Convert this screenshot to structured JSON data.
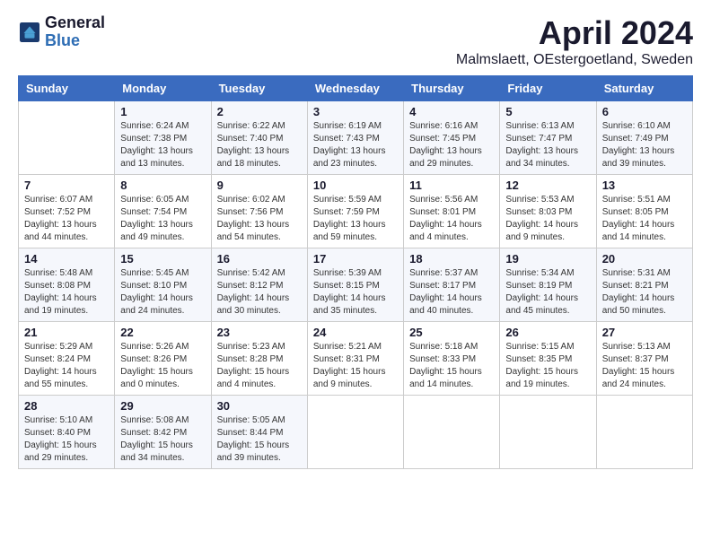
{
  "header": {
    "logo_general": "General",
    "logo_blue": "Blue",
    "month_title": "April 2024",
    "location": "Malmslaett, OEstergoetland, Sweden"
  },
  "calendar": {
    "days_of_week": [
      "Sunday",
      "Monday",
      "Tuesday",
      "Wednesday",
      "Thursday",
      "Friday",
      "Saturday"
    ],
    "weeks": [
      [
        {
          "day": "",
          "info": ""
        },
        {
          "day": "1",
          "info": "Sunrise: 6:24 AM\nSunset: 7:38 PM\nDaylight: 13 hours\nand 13 minutes."
        },
        {
          "day": "2",
          "info": "Sunrise: 6:22 AM\nSunset: 7:40 PM\nDaylight: 13 hours\nand 18 minutes."
        },
        {
          "day": "3",
          "info": "Sunrise: 6:19 AM\nSunset: 7:43 PM\nDaylight: 13 hours\nand 23 minutes."
        },
        {
          "day": "4",
          "info": "Sunrise: 6:16 AM\nSunset: 7:45 PM\nDaylight: 13 hours\nand 29 minutes."
        },
        {
          "day": "5",
          "info": "Sunrise: 6:13 AM\nSunset: 7:47 PM\nDaylight: 13 hours\nand 34 minutes."
        },
        {
          "day": "6",
          "info": "Sunrise: 6:10 AM\nSunset: 7:49 PM\nDaylight: 13 hours\nand 39 minutes."
        }
      ],
      [
        {
          "day": "7",
          "info": "Sunrise: 6:07 AM\nSunset: 7:52 PM\nDaylight: 13 hours\nand 44 minutes."
        },
        {
          "day": "8",
          "info": "Sunrise: 6:05 AM\nSunset: 7:54 PM\nDaylight: 13 hours\nand 49 minutes."
        },
        {
          "day": "9",
          "info": "Sunrise: 6:02 AM\nSunset: 7:56 PM\nDaylight: 13 hours\nand 54 minutes."
        },
        {
          "day": "10",
          "info": "Sunrise: 5:59 AM\nSunset: 7:59 PM\nDaylight: 13 hours\nand 59 minutes."
        },
        {
          "day": "11",
          "info": "Sunrise: 5:56 AM\nSunset: 8:01 PM\nDaylight: 14 hours\nand 4 minutes."
        },
        {
          "day": "12",
          "info": "Sunrise: 5:53 AM\nSunset: 8:03 PM\nDaylight: 14 hours\nand 9 minutes."
        },
        {
          "day": "13",
          "info": "Sunrise: 5:51 AM\nSunset: 8:05 PM\nDaylight: 14 hours\nand 14 minutes."
        }
      ],
      [
        {
          "day": "14",
          "info": "Sunrise: 5:48 AM\nSunset: 8:08 PM\nDaylight: 14 hours\nand 19 minutes."
        },
        {
          "day": "15",
          "info": "Sunrise: 5:45 AM\nSunset: 8:10 PM\nDaylight: 14 hours\nand 24 minutes."
        },
        {
          "day": "16",
          "info": "Sunrise: 5:42 AM\nSunset: 8:12 PM\nDaylight: 14 hours\nand 30 minutes."
        },
        {
          "day": "17",
          "info": "Sunrise: 5:39 AM\nSunset: 8:15 PM\nDaylight: 14 hours\nand 35 minutes."
        },
        {
          "day": "18",
          "info": "Sunrise: 5:37 AM\nSunset: 8:17 PM\nDaylight: 14 hours\nand 40 minutes."
        },
        {
          "day": "19",
          "info": "Sunrise: 5:34 AM\nSunset: 8:19 PM\nDaylight: 14 hours\nand 45 minutes."
        },
        {
          "day": "20",
          "info": "Sunrise: 5:31 AM\nSunset: 8:21 PM\nDaylight: 14 hours\nand 50 minutes."
        }
      ],
      [
        {
          "day": "21",
          "info": "Sunrise: 5:29 AM\nSunset: 8:24 PM\nDaylight: 14 hours\nand 55 minutes."
        },
        {
          "day": "22",
          "info": "Sunrise: 5:26 AM\nSunset: 8:26 PM\nDaylight: 15 hours\nand 0 minutes."
        },
        {
          "day": "23",
          "info": "Sunrise: 5:23 AM\nSunset: 8:28 PM\nDaylight: 15 hours\nand 4 minutes."
        },
        {
          "day": "24",
          "info": "Sunrise: 5:21 AM\nSunset: 8:31 PM\nDaylight: 15 hours\nand 9 minutes."
        },
        {
          "day": "25",
          "info": "Sunrise: 5:18 AM\nSunset: 8:33 PM\nDaylight: 15 hours\nand 14 minutes."
        },
        {
          "day": "26",
          "info": "Sunrise: 5:15 AM\nSunset: 8:35 PM\nDaylight: 15 hours\nand 19 minutes."
        },
        {
          "day": "27",
          "info": "Sunrise: 5:13 AM\nSunset: 8:37 PM\nDaylight: 15 hours\nand 24 minutes."
        }
      ],
      [
        {
          "day": "28",
          "info": "Sunrise: 5:10 AM\nSunset: 8:40 PM\nDaylight: 15 hours\nand 29 minutes."
        },
        {
          "day": "29",
          "info": "Sunrise: 5:08 AM\nSunset: 8:42 PM\nDaylight: 15 hours\nand 34 minutes."
        },
        {
          "day": "30",
          "info": "Sunrise: 5:05 AM\nSunset: 8:44 PM\nDaylight: 15 hours\nand 39 minutes."
        },
        {
          "day": "",
          "info": ""
        },
        {
          "day": "",
          "info": ""
        },
        {
          "day": "",
          "info": ""
        },
        {
          "day": "",
          "info": ""
        }
      ]
    ]
  }
}
